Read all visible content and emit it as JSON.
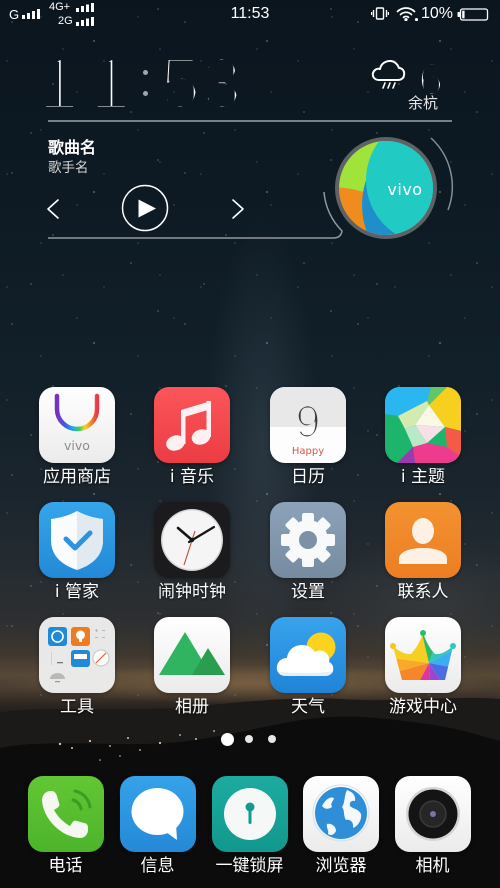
{
  "status_bar": {
    "network_1": {
      "type": "G",
      "signal_bars": 4
    },
    "network_2": {
      "type": "4G+",
      "signal_bars": 4
    },
    "network_3": {
      "type": "2G",
      "signal_bars": 4
    },
    "time": "11:53",
    "vibrate_icon": "vibrate-icon",
    "wifi_icon": "wifi-icon",
    "battery_text": "10%",
    "battery_level": 0.1
  },
  "clock_widget": {
    "hours": "11",
    "separator": ":",
    "minutes": "53",
    "weather_icon": "rain-cloud-icon",
    "temperature": "6°",
    "city": "余杭"
  },
  "music_widget": {
    "song_title": "歌曲名",
    "artist": "歌手名",
    "controls": {
      "previous": "chevron-left-icon",
      "play": "play-icon",
      "next": "chevron-right-icon"
    },
    "album_logo_text": "vivo"
  },
  "apps": [
    {
      "label": "应用商店",
      "icon": "app-store-icon",
      "logo_text": "vivo"
    },
    {
      "label": "i 音乐",
      "icon": "music-note-icon"
    },
    {
      "label": "日历",
      "icon": "calendar-icon",
      "day": "9",
      "caption": "Happy"
    },
    {
      "label": "i 主题",
      "icon": "theme-icon"
    },
    {
      "label": "i 管家",
      "icon": "shield-check-icon"
    },
    {
      "label": "闹钟时钟",
      "icon": "clock-icon"
    },
    {
      "label": "设置",
      "icon": "gear-icon"
    },
    {
      "label": "联系人",
      "icon": "contact-person-icon"
    },
    {
      "label": "工具",
      "icon": "tools-folder-icon"
    },
    {
      "label": "相册",
      "icon": "gallery-mountain-icon"
    },
    {
      "label": "天气",
      "icon": "weather-sun-cloud-icon"
    },
    {
      "label": "游戏中心",
      "icon": "game-crown-icon"
    }
  ],
  "page_indicator": {
    "page_count": 3,
    "current_page": 1
  },
  "dock": [
    {
      "label": "电话",
      "icon": "phone-icon"
    },
    {
      "label": "信息",
      "icon": "message-bubble-icon"
    },
    {
      "label": "一键锁屏",
      "icon": "lock-keyhole-icon"
    },
    {
      "label": "浏览器",
      "icon": "globe-icon"
    },
    {
      "label": "相机",
      "icon": "camera-lens-icon"
    }
  ],
  "colors": {
    "music_red": "#f2474d",
    "shield_blue": "#2b93df",
    "settings_slate": "#7f94a9",
    "contacts_orange": "#f08526",
    "phone_green": "#56bf2f",
    "messages_blue": "#2d95dd",
    "lock_teal": "#16a095",
    "sun_yellow": "#fbd31f",
    "album_teal": "#22cbc4"
  }
}
